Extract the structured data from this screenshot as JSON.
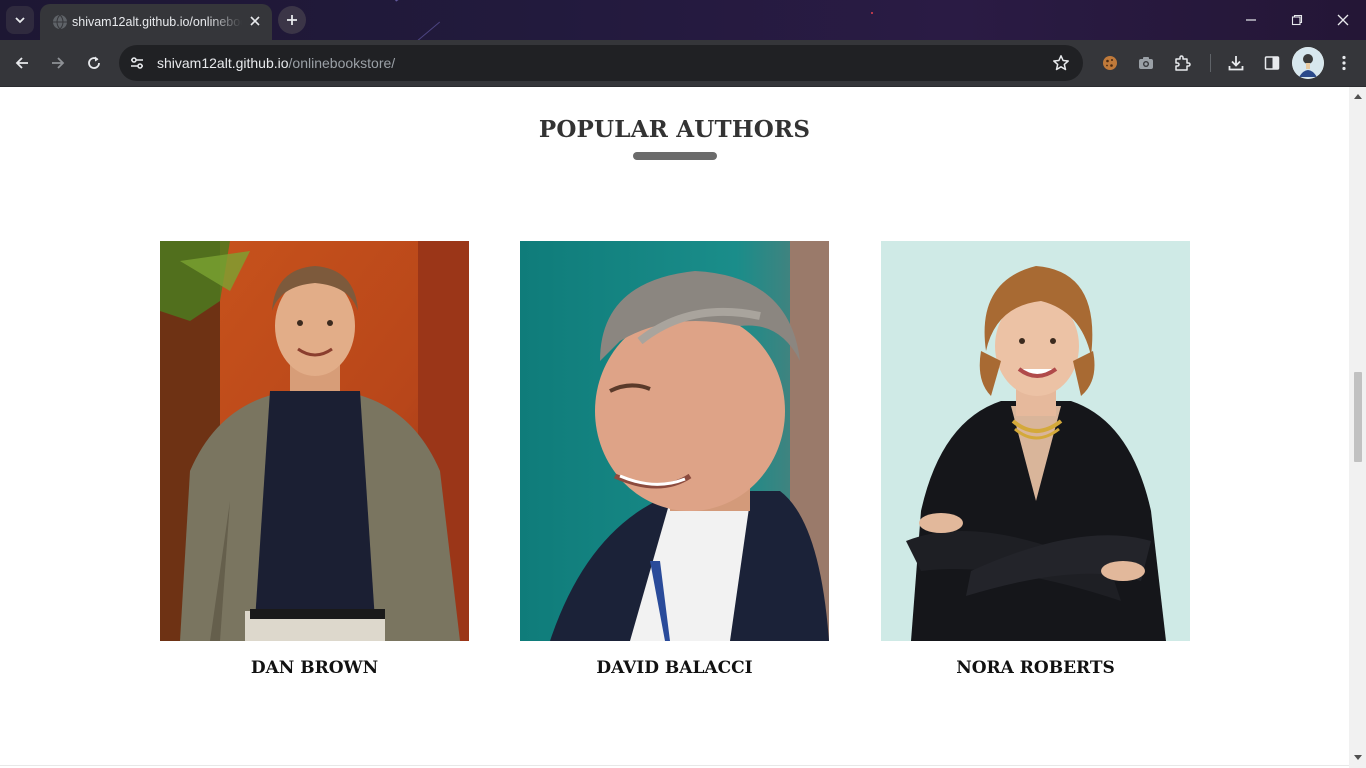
{
  "browser": {
    "tab_title": "shivam12alt.github.io/onlinebookstore/",
    "url_host": "shivam12alt.github.io",
    "url_path": "/onlinebookstore/"
  },
  "page": {
    "section_title": "POPULAR AUTHORS",
    "authors": [
      {
        "name": "DAN BROWN"
      },
      {
        "name": "DAVID BALACCI"
      },
      {
        "name": "NORA ROBERTS"
      }
    ]
  },
  "icons": {
    "tab_search": "chevron-down-icon",
    "new_tab": "plus-icon",
    "back": "arrow-left-icon",
    "forward": "arrow-right-icon",
    "reload": "reload-icon",
    "site_info": "tune-icon",
    "bookmark": "star-icon",
    "extensions": [
      "cookie-extension-icon",
      "camera-extension-icon",
      "puzzle-icon"
    ],
    "downloads": "download-icon",
    "side_panel": "side-panel-icon",
    "menu": "kebab-menu-icon"
  },
  "colors": {
    "tab_active": "#35363a",
    "omnibox": "#202124",
    "title_text": "#333333",
    "underline": "#6b6b6b"
  }
}
